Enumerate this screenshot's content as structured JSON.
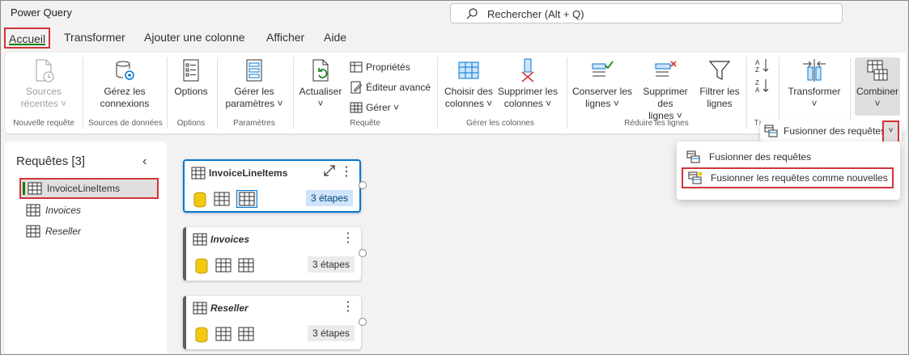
{
  "app": {
    "title": "Power Query"
  },
  "search": {
    "text": "Rechercher (Alt + Q)"
  },
  "tabs": [
    "Accueil",
    "Transformer",
    "Ajouter une colonne",
    "Afficher",
    "Aide"
  ],
  "ribbon": {
    "sources_l1": "Sources",
    "sources_l2": "récentes ˅",
    "connections_l1": "Gérez les",
    "connections_l2": "connexions",
    "options": "Options",
    "params_l1": "Gérer les",
    "params_l2": "paramètres ˅",
    "refresh_l1": "Actualiser",
    "refresh_l2": "˅",
    "properties": "Propriétés",
    "advanced_editor": "Éditeur avancé",
    "manage": "Gérer ˅",
    "choose_cols_l1": "Choisir des",
    "choose_cols_l2": "colonnes ˅",
    "remove_cols_l1": "Supprimer les",
    "remove_cols_l2": "colonnes ˅",
    "keep_rows_l1": "Conserver les",
    "keep_rows_l2": "lignes ˅",
    "remove_rows_l1": "Supprimer des",
    "remove_rows_l2": "lignes ˅",
    "filter_rows_l1": "Filtrer les",
    "filter_rows_l2": "lignes",
    "transform_l1": "Transformer",
    "transform_l2": "˅",
    "combine_l1": "Combiner",
    "combine_l2": "˅",
    "groups": {
      "new_query": "Nouvelle requête",
      "data_sources": "Sources de données",
      "options": "Options",
      "parameters": "Paramètres",
      "query": "Requête",
      "manage_columns": "Gérer les colonnes",
      "reduce_rows": "Réduire les lignes",
      "sort_short": "Tı"
    }
  },
  "merge_split": {
    "label": "Fusionner des requêtes",
    "caret": "˅"
  },
  "merge_menu": {
    "items": [
      "Fusionner des requêtes",
      "Fusionner les requêtes comme nouvelles"
    ]
  },
  "queries_panel": {
    "title": "Requêtes [3]",
    "collapse": "‹",
    "items": [
      "InvoiceLineItems",
      "Invoices",
      "Reseller"
    ]
  },
  "cards": [
    {
      "title": "InvoiceLineItems",
      "steps": "3 étapes"
    },
    {
      "title": "Invoices",
      "steps": "3 étapes"
    },
    {
      "title": "Reseller",
      "steps": "3 étapes"
    }
  ],
  "colors": {
    "accent_green": "#107c10",
    "highlight_red": "#d13438",
    "select_blue": "#0078d4"
  }
}
